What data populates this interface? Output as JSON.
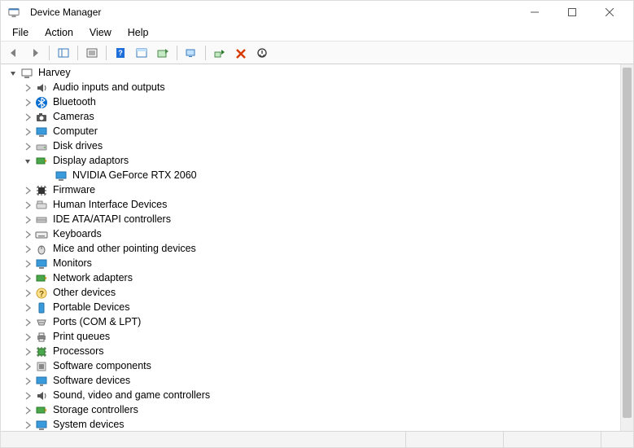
{
  "window": {
    "title": "Device Manager"
  },
  "menubar": {
    "file": "File",
    "action": "Action",
    "view": "View",
    "help": "Help"
  },
  "tree": {
    "root": "Harvey",
    "audio": "Audio inputs and outputs",
    "bluetooth": "Bluetooth",
    "cameras": "Cameras",
    "computer": "Computer",
    "disk": "Disk drives",
    "display": "Display adaptors",
    "display_child": "NVIDIA GeForce RTX 2060",
    "firmware": "Firmware",
    "hid": "Human Interface Devices",
    "ide": "IDE ATA/ATAPI controllers",
    "keyboards": "Keyboards",
    "mice": "Mice and other pointing devices",
    "monitors": "Monitors",
    "network": "Network adapters",
    "other": "Other devices",
    "portable": "Portable Devices",
    "ports": "Ports (COM & LPT)",
    "printqueues": "Print queues",
    "processors": "Processors",
    "swcomponents": "Software components",
    "swdevices": "Software devices",
    "sound": "Sound, video and game controllers",
    "storage": "Storage controllers",
    "system": "System devices"
  }
}
